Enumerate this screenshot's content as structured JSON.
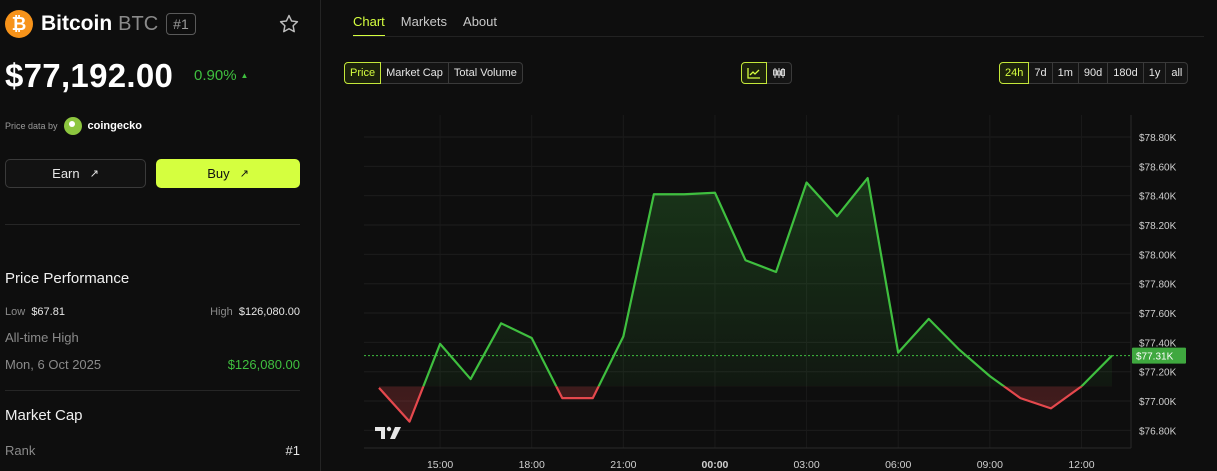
{
  "coin": {
    "logo_glyph": "₿",
    "name": "Bitcoin",
    "symbol": "BTC",
    "rank_badge": "#1",
    "price": "$77,192.00",
    "change": "0.90%",
    "change_arrow": "▲",
    "price_data_by": "Price data by",
    "provider": "coingecko"
  },
  "actions": {
    "earn_label": "Earn",
    "buy_label": "Buy",
    "arrow": "↗"
  },
  "performance": {
    "title": "Price Performance",
    "low_label": "Low",
    "low_value": "$67.81",
    "high_label": "High",
    "high_value": "$126,080.00",
    "ath_label": "All-time High",
    "ath_date": "Mon, 6 Oct 2025",
    "ath_value": "$126,080.00"
  },
  "market_cap": {
    "title": "Market Cap",
    "rank_label": "Rank",
    "rank_value": "#1"
  },
  "tabs": [
    {
      "label": "Chart",
      "active": true
    },
    {
      "label": "Markets",
      "active": false
    },
    {
      "label": "About",
      "active": false
    }
  ],
  "metric_toggle": [
    {
      "label": "Price",
      "active": true
    },
    {
      "label": "Market Cap",
      "active": false
    },
    {
      "label": "Total Volume",
      "active": false
    }
  ],
  "chart_type_toggle": [
    {
      "icon": "line-chart-icon",
      "active": true
    },
    {
      "icon": "candlestick-icon",
      "active": false
    }
  ],
  "ranges": [
    {
      "label": "24h",
      "active": true
    },
    {
      "label": "7d",
      "active": false
    },
    {
      "label": "1m",
      "active": false
    },
    {
      "label": "90d",
      "active": false
    },
    {
      "label": "180d",
      "active": false
    },
    {
      "label": "1y",
      "active": false
    },
    {
      "label": "all",
      "active": false
    }
  ],
  "colors": {
    "accent": "#d5ff3f",
    "up": "#3fbf3f",
    "down": "#e5484d",
    "bitcoin": "#f7931a"
  },
  "chart_data": {
    "type": "line",
    "x": [
      "13:30",
      "14:30",
      "15:00",
      "15:30",
      "16:30",
      "17:30",
      "18:30",
      "19:30",
      "20:30",
      "21:30",
      "22:30",
      "23:30",
      "00:30",
      "01:30",
      "02:30",
      "03:30",
      "04:30",
      "05:30",
      "06:30",
      "07:30",
      "08:30",
      "09:30",
      "10:30",
      "11:30",
      "12:30"
    ],
    "series": [
      {
        "values": [
          77090,
          76860,
          77390,
          77150,
          77530,
          77430,
          77020,
          77020,
          77440,
          78410,
          78410,
          78420,
          77960,
          77880,
          78490,
          78260,
          78520,
          77330,
          77560,
          77350,
          77170,
          77020,
          76950,
          77100,
          77310
        ]
      }
    ],
    "baseline": 77100,
    "current_value_label": "$77.31K",
    "current_value": 77310,
    "ylim": [
      76680,
      78950
    ],
    "yticks": [
      76800,
      77000,
      77200,
      77400,
      77600,
      77800,
      78000,
      78200,
      78400,
      78600,
      78800
    ],
    "ytick_labels": [
      "$76.80K",
      "$77.00K",
      "$77.20K",
      "$77.40K",
      "$77.60K",
      "$77.80K",
      "$78.00K",
      "$78.20K",
      "$78.40K",
      "$78.60K",
      "$78.80K"
    ],
    "xticks": [
      {
        "label": "15:00",
        "index": 2,
        "bold": false
      },
      {
        "label": "18:00",
        "index": 5,
        "bold": false
      },
      {
        "label": "21:00",
        "index": 8,
        "bold": false
      },
      {
        "label": "00:00",
        "index": 11,
        "bold": true
      },
      {
        "label": "03:00",
        "index": 14,
        "bold": false
      },
      {
        "label": "06:00",
        "index": 17,
        "bold": false
      },
      {
        "label": "09:00",
        "index": 20,
        "bold": false
      },
      {
        "label": "12:00",
        "index": 23,
        "bold": false
      }
    ],
    "grid": true
  }
}
